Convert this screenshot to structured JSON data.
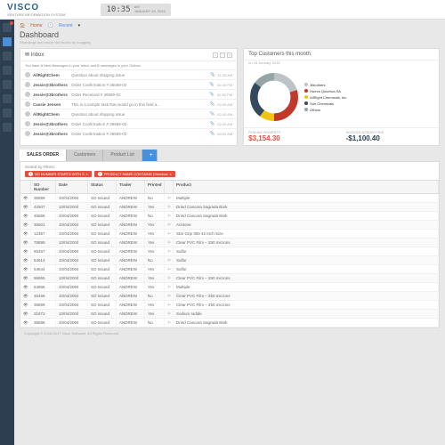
{
  "brand": {
    "name": "VISCO",
    "tagline": "VENTURE INFORMATION SYSTEM"
  },
  "clock": {
    "time": "10:35",
    "ampm": "AM",
    "date": "JANUARY 25, 2015"
  },
  "sidebar": {
    "items": [
      "alerts",
      "dashboard",
      "orders",
      "mail",
      "users",
      "reports",
      "charts",
      "close"
    ]
  },
  "breadcrumb": {
    "home": "Home",
    "recent": "Recent"
  },
  "dashboard": {
    "title": "Dashboard",
    "subtitle": "Rearrange and resize the blocks by dragging"
  },
  "inbox": {
    "title": "Inbox",
    "summary_pre": "You have ",
    "summary_new": "4",
    "summary_mid": " New Messages in your Inbox and ",
    "summary_out": "0",
    "summary_post": " messages in your Outbox",
    "rows": [
      {
        "sender": "AllRightChem",
        "subject": "Question about shipping issue",
        "time": "11:30 AM"
      },
      {
        "sender": "Jessie@3brothers",
        "subject": "Order Confirmation # 36589-02",
        "time": "02:40 PM"
      },
      {
        "sender": "Jessie@3brothers",
        "subject": "Order Received # 36589-02",
        "time": "02:50 PM"
      },
      {
        "sender": "Cassie Jensen",
        "subject": "This is a sample task that would go in this field a...",
        "time": "02:40 AM"
      },
      {
        "sender": "AllRightChem",
        "subject": "Question about shipping issue",
        "time": "02:40 AM"
      },
      {
        "sender": "Jessie@3brothers",
        "subject": "Order Confirmation # 36589-02",
        "time": "02:40 AM"
      },
      {
        "sender": "Jessie@3brothers",
        "subject": "Order Confirmation # 36589-02",
        "time": "00:00 AM"
      }
    ]
  },
  "customers": {
    "title": "Top Customers this month:",
    "subtitle": "on 25 January 2015",
    "legend": [
      {
        "name": "3Brothers",
        "color": "#bdc3c7"
      },
      {
        "name": "Hueva Qucmica SA",
        "color": "#c0392b"
      },
      {
        "name": "AllRight Chemicals, Inc",
        "color": "#f1c40f"
      },
      {
        "name": "Sun Chemicals",
        "color": "#34495e"
      },
      {
        "name": "Others",
        "color": "#95a5a6"
      }
    ],
    "pending_label": "PENDING PAYMENTS",
    "pending_value": "$3,154.30",
    "paid_label": "INVOICES ALREADY PAID",
    "paid_value": "-$1,100.40"
  },
  "chart_data": {
    "type": "pie",
    "title": "Top Customers this month",
    "series": [
      {
        "name": "3Brothers",
        "value": 20,
        "color": "#bdc3c7"
      },
      {
        "name": "Hueva Qucmica SA",
        "value": 30,
        "color": "#c0392b"
      },
      {
        "name": "AllRight Chemicals, Inc",
        "value": 10,
        "color": "#f1c40f"
      },
      {
        "name": "Sun Chemicals",
        "value": 25,
        "color": "#34495e"
      },
      {
        "name": "Others",
        "value": 15,
        "color": "#95a5a6"
      }
    ]
  },
  "tabs": {
    "sales": "SALES ORDER",
    "customers": "Customers",
    "products": "Product List"
  },
  "filters": {
    "label": "Sorted by Filters:",
    "chips": [
      {
        "n": "1",
        "text": "SO NUMBER STARTS WITH 3"
      },
      {
        "n": "2",
        "text": "PRODUCT NAME CONTAINS Chemical"
      }
    ]
  },
  "grid": {
    "headers": [
      "",
      "SO Number",
      "Date",
      "Status",
      "Trader",
      "Printed",
      "",
      "Product"
    ],
    "rows": [
      {
        "so": "36589",
        "date": "10/04/2004",
        "status": "SO Issued",
        "trader": "ANDREW",
        "printed": "No",
        "product": "Multiple"
      },
      {
        "so": "42507",
        "date": "10/04/2004",
        "status": "SO Issued",
        "trader": "ANDREW",
        "printed": "Yes",
        "product": "Dried Cascara Sagrada Bark"
      },
      {
        "so": "45668",
        "date": "10/04/2004",
        "status": "SO Issued",
        "trader": "ANDREW",
        "printed": "No",
        "product": "Dried Cascara Sagrada Bark"
      },
      {
        "so": "36501",
        "date": "10/04/2004",
        "status": "SO Issued",
        "trader": "ANDREW",
        "printed": "Yes",
        "product": "Acetone"
      },
      {
        "so": "12367",
        "date": "10/04/2004",
        "status": "SO Issued",
        "trader": "ANDREW",
        "printed": "Yes",
        "product": "Star Grip 300 42 Inch Size"
      },
      {
        "so": "78899",
        "date": "10/04/2004",
        "status": "SO Issued",
        "trader": "ANDREW",
        "printed": "Yes",
        "product": "Clear PVC Film – 250 microns"
      },
      {
        "so": "65457",
        "date": "10/04/2004",
        "status": "SO Issued",
        "trader": "ANDREW",
        "printed": "Yes",
        "product": "Sulfur"
      },
      {
        "so": "54914",
        "date": "10/04/2004",
        "status": "SO Issued",
        "trader": "ANDREW",
        "printed": "No",
        "product": "Sulfur"
      },
      {
        "so": "54644",
        "date": "10/04/2004",
        "status": "SO Issued",
        "trader": "ANDREW",
        "printed": "Yes",
        "product": "Sulfur"
      },
      {
        "so": "56855",
        "date": "10/04/2004",
        "status": "SO Issued",
        "trader": "ANDREW",
        "printed": "Yes",
        "product": "Clear PVC Film – 250 microns"
      },
      {
        "so": "54556",
        "date": "10/04/2004",
        "status": "SO Issued",
        "trader": "ANDREW",
        "printed": "Yes",
        "product": "Multiple"
      },
      {
        "so": "46456",
        "date": "10/04/2004",
        "status": "SO Issued",
        "trader": "ANDREW",
        "printed": "No",
        "product": "Clear PVC Film – 250 microns"
      },
      {
        "so": "35889",
        "date": "10/04/2004",
        "status": "SO Issued",
        "trader": "ANDREW",
        "printed": "Yes",
        "product": "Clear PVC Film – 250 microns"
      },
      {
        "so": "31872",
        "date": "10/04/2004",
        "status": "SO Issued",
        "trader": "ANDREW",
        "printed": "Yes",
        "product": "Sodium Iodide"
      },
      {
        "so": "36888",
        "date": "10/04/2004",
        "status": "SO Issued",
        "trader": "ANDREW",
        "printed": "No",
        "product": "Dried Cascara Sagrada Bark"
      }
    ]
  },
  "footer": "Copyright © 2016-2017 Visco Software. All Rights Reserved"
}
